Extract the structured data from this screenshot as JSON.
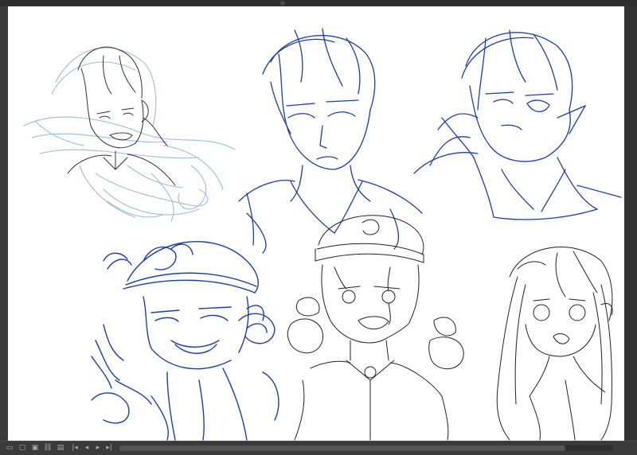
{
  "app": {
    "accent_color": "#1a3fa8",
    "light_sketch_color": "#9bbde0",
    "ink_color": "#222222"
  },
  "canvas": {
    "sketches": [
      {
        "name": "sketch-boy-grimace-light-blue",
        "stroke": "light-blue+ink"
      },
      {
        "name": "sketch-boy-blue-center-top",
        "stroke": "blue"
      },
      {
        "name": "sketch-boy-glasses-blue",
        "stroke": "blue"
      },
      {
        "name": "sketch-hanako-blue-cap",
        "stroke": "blue"
      },
      {
        "name": "sketch-hanako-crying-ink",
        "stroke": "ink"
      },
      {
        "name": "sketch-girl-long-hair-ink",
        "stroke": "ink"
      }
    ]
  },
  "bottom_toolbar": {
    "icons": [
      "layer-icon",
      "frame-icon",
      "folder-icon",
      "link-icon",
      "page-icon",
      "nav-first-icon",
      "nav-prev-icon",
      "nav-next-icon",
      "nav-last-icon"
    ],
    "glyphs": [
      "▭",
      "▢",
      "▣",
      "⛓",
      "▤",
      "|◂",
      "◂",
      "▸",
      "▸|"
    ]
  }
}
